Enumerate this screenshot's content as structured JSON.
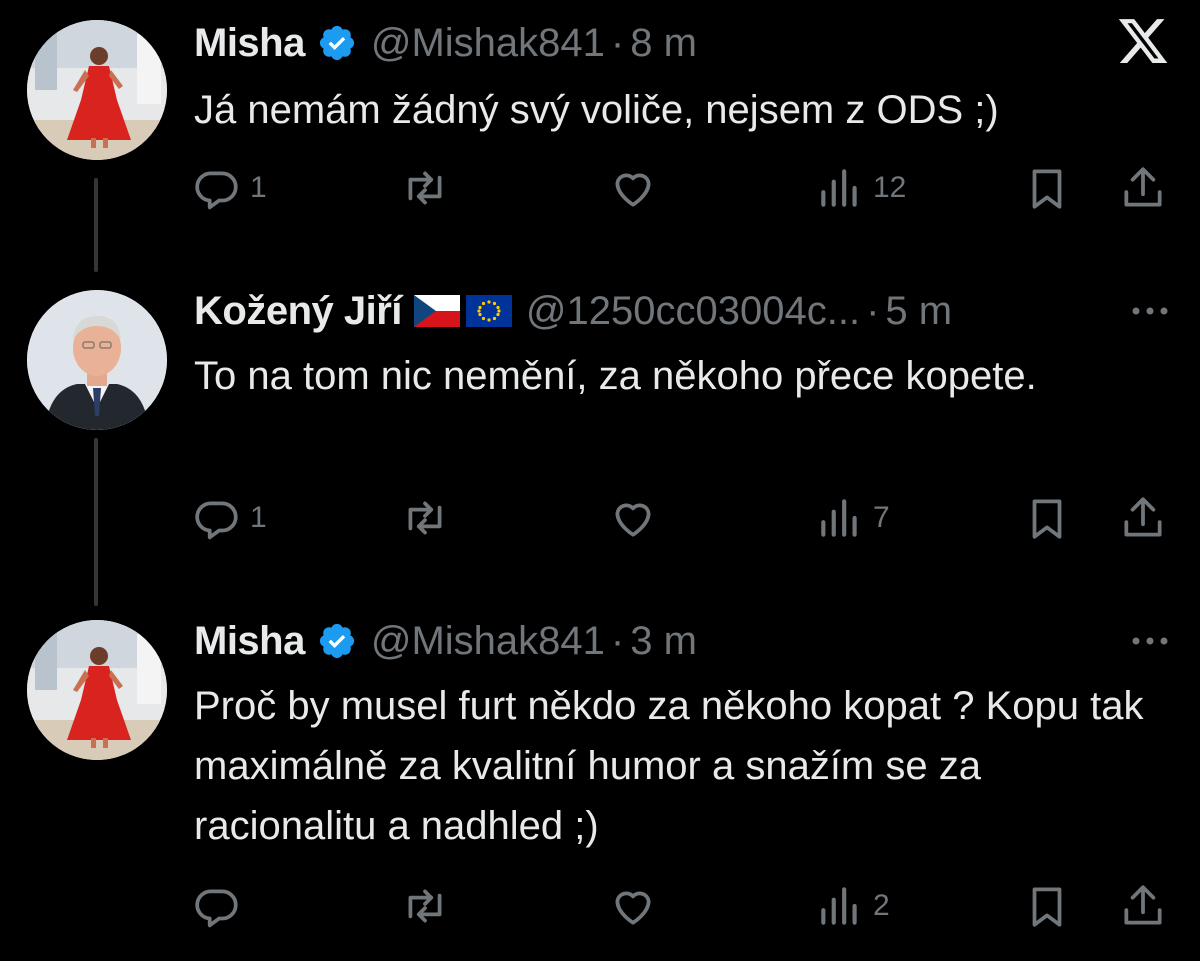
{
  "thread": {
    "tweets": [
      {
        "author": "Misha",
        "verified": true,
        "handle": "@Mishak841",
        "separator": "·",
        "time": "8 m",
        "text": "Já nemám žádný svý voliče, nejsem z ODS ;)",
        "corner_icon": "x-close-icon",
        "replies": "1",
        "reposts": "",
        "likes": "",
        "views": "12"
      },
      {
        "author": "Kožený Jiří",
        "verified": false,
        "flags": [
          "czech-flag",
          "eu-flag"
        ],
        "handle": "@1250cc03004c...",
        "separator": "·",
        "time": "5 m",
        "text": "To na tom nic nemění, za někoho přece kopete.",
        "corner_icon": "more-icon",
        "replies": "1",
        "reposts": "",
        "likes": "",
        "views": "7"
      },
      {
        "author": "Misha",
        "verified": true,
        "handle": "@Mishak841",
        "separator": "·",
        "time": "3 m",
        "text": "Proč by musel furt někdo za někoho kopat ? Kopu tak maximálně za kvalitní humor a snažím se za racionalitu a nadhled ;)",
        "corner_icon": "more-icon",
        "replies": "",
        "reposts": "",
        "likes": "",
        "views": "2"
      }
    ]
  },
  "colors": {
    "background": "#000000",
    "text": "#e7e9ea",
    "muted": "#71767b",
    "verified": "#1d9bf0",
    "thread_line": "#333639"
  }
}
